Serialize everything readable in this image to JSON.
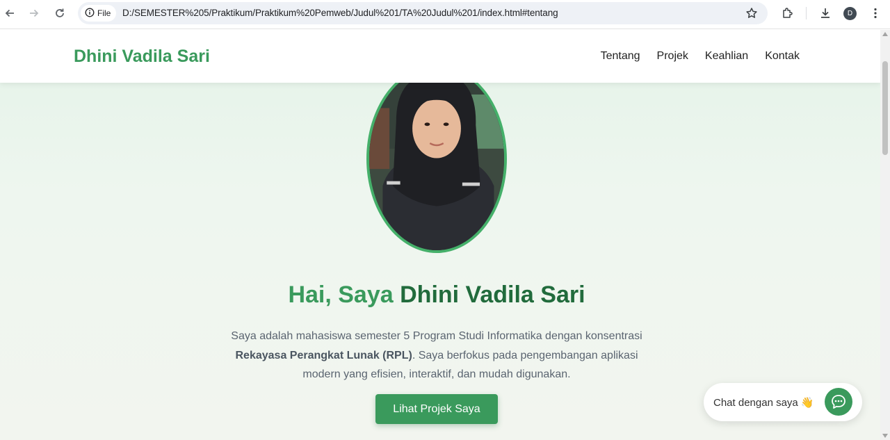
{
  "browser": {
    "chip_label": "File",
    "url": "D:/SEMESTER%205/Praktikum/Praktikum%20Pemweb/Judul%201/TA%20Judul%201/index.html#tentang",
    "profile_initial": "D"
  },
  "site": {
    "brand": "Dhini Vadila Sari",
    "nav": [
      "Tentang",
      "Projek",
      "Keahlian",
      "Kontak"
    ]
  },
  "hero": {
    "title_prefix": "Hai, Saya",
    "title_name": "Dhini Vadila Sari",
    "desc_part1": "Saya adalah mahasiswa semester 5 Program Studi Informatika dengan konsentrasi",
    "desc_bold": "Rekayasa Perangkat Lunak (RPL)",
    "desc_part2": ". Saya berfokus pada pengembangan aplikasi modern yang efisien, interaktif, dan mudah digunakan.",
    "cta_label": "Lihat Projek Saya",
    "photo_icon": "profile-photo"
  },
  "chat": {
    "label": "Chat dengan saya 👋",
    "icon": "chat-icon"
  },
  "colors": {
    "brand_green": "#3a9a5c",
    "dark_green": "#216b3c",
    "frame_green": "#45b06a"
  }
}
